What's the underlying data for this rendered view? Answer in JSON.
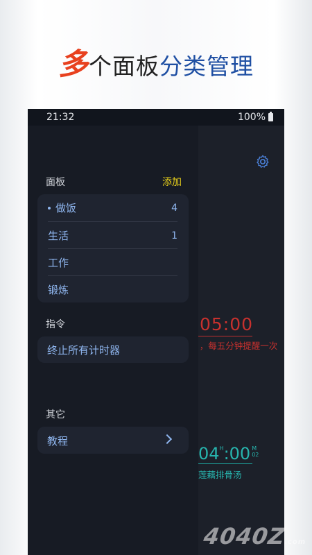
{
  "headline": {
    "emphasis": "多",
    "part1": "个面板",
    "part2": "分类管理"
  },
  "statusbar": {
    "time": "21:32",
    "battery": "100%"
  },
  "drawer": {
    "board_section": "面板",
    "add_label": "添加",
    "boards": [
      {
        "name": "做饭",
        "count": "4",
        "selected": true
      },
      {
        "name": "生活",
        "count": "1",
        "selected": false
      },
      {
        "name": "工作",
        "count": "",
        "selected": false
      },
      {
        "name": "锻炼",
        "count": "",
        "selected": false
      }
    ],
    "command_section": "指令",
    "stop_all": "终止所有计时器",
    "other_section": "其它",
    "tutorial": "教程"
  },
  "timers": [
    {
      "display": "05:00",
      "desc": "，每五分钟提醒一次",
      "color": "#c0302f"
    },
    {
      "display_h": "04",
      "hour_unit": "H",
      "display_m": ":00",
      "minute_unit": "M",
      "minute_sub": "02",
      "desc": "莲藕排骨汤",
      "color": "#1ea6a0"
    }
  ],
  "colors": {
    "accent_blue": "#8fb6ef",
    "add_yellow": "#e9d11a",
    "headline_red": "#e8411f",
    "headline_blue": "#1f4fa3"
  },
  "icons": {
    "settings": "gear-icon",
    "chevron": "chevron-right-icon",
    "battery": "battery-icon"
  },
  "watermark": {
    "text": "4040Z",
    "sub": ".com"
  }
}
